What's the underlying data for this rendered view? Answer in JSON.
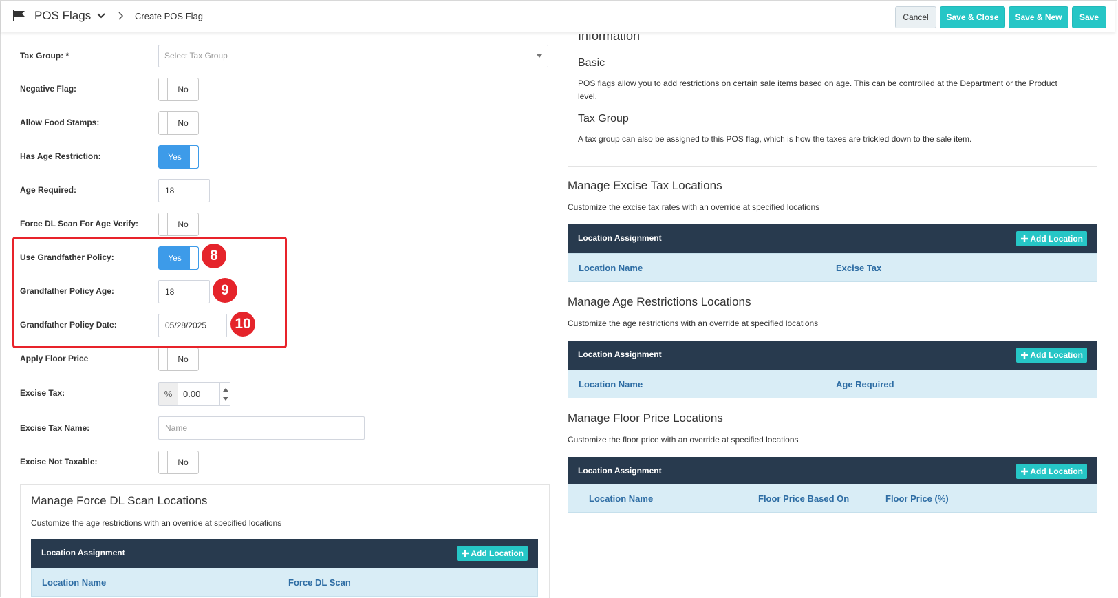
{
  "header": {
    "title": "POS Flags",
    "breadcrumb": "Create POS Flag",
    "buttons": {
      "cancel": "Cancel",
      "save_close": "Save & Close",
      "save_new": "Save & New",
      "save": "Save"
    }
  },
  "form": {
    "tax_group": {
      "label": "Tax Group: *",
      "placeholder": "Select Tax Group"
    },
    "negative_flag": {
      "label": "Negative Flag:",
      "value": "No"
    },
    "allow_food_stamps": {
      "label": "Allow Food Stamps:",
      "value": "No"
    },
    "has_age_restriction": {
      "label": "Has Age Restriction:",
      "value": "Yes"
    },
    "age_required": {
      "label": "Age Required:",
      "value": "18"
    },
    "force_dl_scan": {
      "label": "Force DL Scan For Age Verify:",
      "value": "No"
    },
    "use_grandfather_policy": {
      "label": "Use Grandfather Policy:",
      "value": "Yes"
    },
    "grandfather_policy_age": {
      "label": "Grandfather Policy Age:",
      "value": "18"
    },
    "grandfather_policy_date": {
      "label": "Grandfather Policy Date:",
      "value": "05/28/2025"
    },
    "apply_floor_price": {
      "label": "Apply Floor Price",
      "value": "No"
    },
    "excise_tax": {
      "label": "Excise Tax:",
      "unit": "%",
      "value": "0.00"
    },
    "excise_tax_name": {
      "label": "Excise Tax Name:",
      "placeholder": "Name"
    },
    "excise_not_taxable": {
      "label": "Excise Not Taxable:",
      "value": "No"
    }
  },
  "annotations": {
    "badge_8": "8",
    "badge_9": "9",
    "badge_10": "10"
  },
  "info": {
    "heading_partial": "Information",
    "basic_title": "Basic",
    "basic_text": "POS flags allow you to add restrictions on certain sale items based on age. This can be controlled at the Department or the Product level.",
    "tax_group_title": "Tax Group",
    "tax_group_text": "A tax group can also be assigned to this POS flag, which is how the taxes are trickled down to the sale item."
  },
  "sections": {
    "force_dl": {
      "title": "Manage Force DL Scan Locations",
      "subtitle": "Customize the age restrictions with an override at specified locations",
      "header": "Location Assignment",
      "add": "Add Location",
      "columns": [
        "Location Name",
        "Force DL Scan"
      ]
    },
    "excise": {
      "title": "Manage Excise Tax Locations",
      "subtitle": "Customize the excise tax rates with an override at specified locations",
      "header": "Location Assignment",
      "add": "Add Location",
      "columns": [
        "Location Name",
        "Excise Tax"
      ]
    },
    "age": {
      "title": "Manage Age Restrictions Locations",
      "subtitle": "Customize the age restrictions with an override at specified locations",
      "header": "Location Assignment",
      "add": "Add Location",
      "columns": [
        "Location Name",
        "Age Required"
      ]
    },
    "floor": {
      "title": "Manage Floor Price Locations",
      "subtitle": "Customize the floor price with an override at specified locations",
      "header": "Location Assignment",
      "add": "Add Location",
      "columns": [
        "Location Name",
        "Floor Price Based On",
        "Floor Price (%)"
      ]
    }
  },
  "colors": {
    "accent_teal": "#26c6c6",
    "toggle_on": "#3d9be9",
    "dark_header": "#283a4e",
    "column_bg": "#d9edf6",
    "highlight_red": "#e8232a"
  }
}
